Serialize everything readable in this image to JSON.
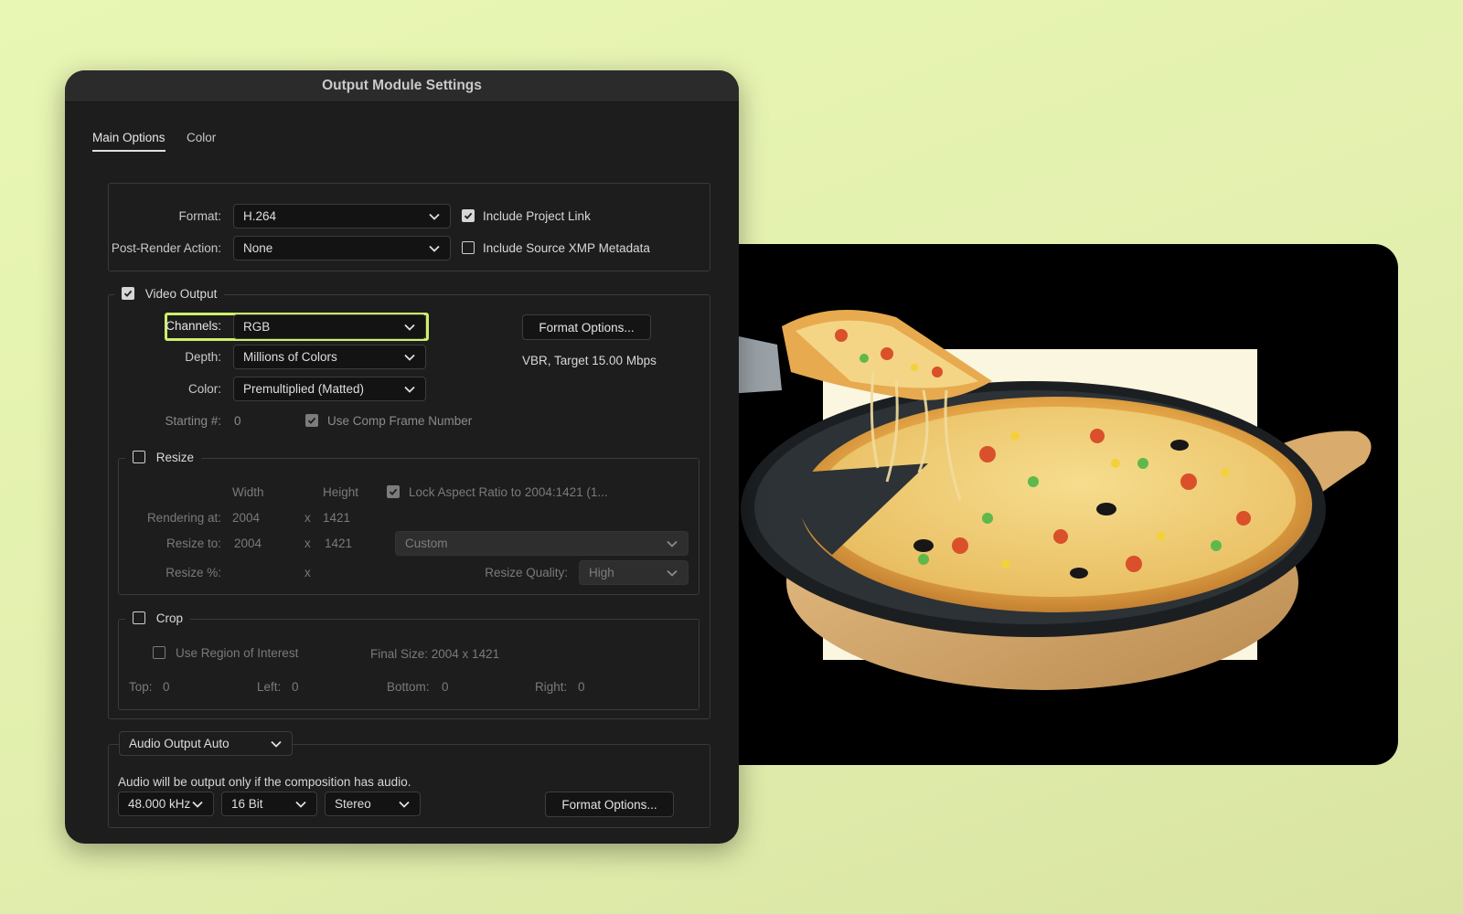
{
  "dialog": {
    "title": "Output Module Settings"
  },
  "tabs": [
    {
      "label": "Main Options",
      "active": true
    },
    {
      "label": "Color",
      "active": false
    }
  ],
  "format_group": {
    "format_label": "Format:",
    "format_value": "H.264",
    "post_render_label": "Post-Render Action:",
    "post_render_value": "None",
    "include_project_link": {
      "label": "Include Project Link",
      "checked": true
    },
    "include_xmp": {
      "label": "Include Source XMP Metadata",
      "checked": false
    }
  },
  "video_output": {
    "title": "Video Output",
    "checked": true,
    "channels_label": "Channels:",
    "channels_value": "RGB",
    "depth_label": "Depth:",
    "depth_value": "Millions of Colors",
    "color_label": "Color:",
    "color_value": "Premultiplied (Matted)",
    "starting_label": "Starting #:",
    "starting_value": "0",
    "use_comp_frame": {
      "label": "Use Comp Frame Number",
      "checked": true
    },
    "format_options_label": "Format Options...",
    "bitrate_text": "VBR, Target 15.00 Mbps"
  },
  "resize": {
    "title": "Resize",
    "checked": false,
    "width_header": "Width",
    "height_header": "Height",
    "lock_aspect": {
      "label": "Lock Aspect Ratio to 2004:1421 (1...",
      "checked": true
    },
    "rendering_label": "Rendering at:",
    "rendering_w": "2004",
    "rendering_h": "1421",
    "resize_to_label": "Resize to:",
    "resize_to_w": "2004",
    "resize_to_h": "1421",
    "times": "x",
    "preset_value": "Custom",
    "resize_pct_label": "Resize %:",
    "quality_label": "Resize Quality:",
    "quality_value": "High"
  },
  "crop": {
    "title": "Crop",
    "checked": false,
    "use_roi": {
      "label": "Use Region of Interest",
      "checked": false
    },
    "final_size": "Final Size: 2004 x 1421",
    "top_label": "Top:",
    "top_value": "0",
    "left_label": "Left:",
    "left_value": "0",
    "bottom_label": "Bottom:",
    "bottom_value": "0",
    "right_label": "Right:",
    "right_value": "0"
  },
  "audio": {
    "mode_value": "Audio Output Auto",
    "note": "Audio will be output only if the composition has audio.",
    "rate_value": "48.000 kHz",
    "bits_value": "16 Bit",
    "channels_value": "Stereo",
    "format_options_label": "Format Options..."
  },
  "icons": {
    "chevron": "chevron-down-icon",
    "check": "checkmark-icon"
  },
  "colors": {
    "background": "#e6f4b0",
    "dialog_bg": "#1d1d1d",
    "highlight": "#cdf06a"
  }
}
